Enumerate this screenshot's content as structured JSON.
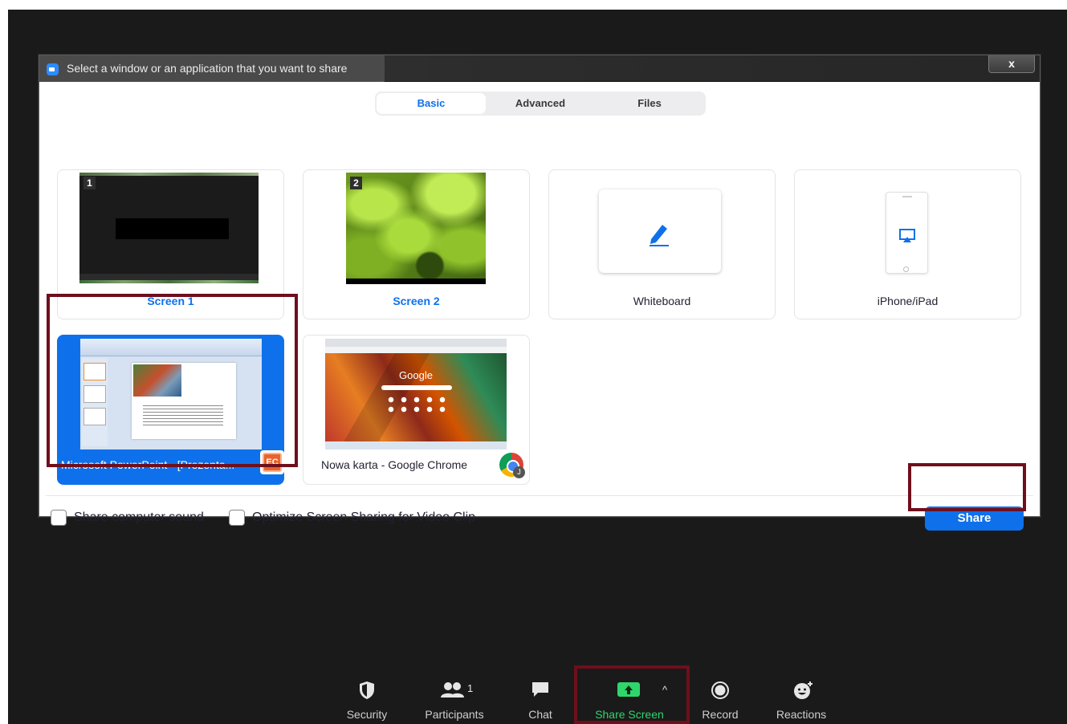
{
  "dialog": {
    "title": "Select a window or an application that you want to share",
    "close_label": "x"
  },
  "tabs": [
    {
      "label": "Basic",
      "active": true
    },
    {
      "label": "Advanced",
      "active": false
    },
    {
      "label": "Files",
      "active": false
    }
  ],
  "tiles": {
    "screen1": {
      "label": "Screen 1",
      "number": "1"
    },
    "screen2": {
      "label": "Screen 2",
      "number": "2"
    },
    "whiteboard": {
      "label": "Whiteboard",
      "icon": "pen-icon"
    },
    "iphone": {
      "label": "iPhone/iPad",
      "icon": "airplay-icon"
    },
    "powerpoint": {
      "label": "Microsoft PowerPoint - [Prezenta...",
      "badge_text": "EC",
      "selected": true
    },
    "chrome": {
      "label": "Nowa karta - Google Chrome",
      "thumb_text": "Google",
      "avatar_letter": "J"
    }
  },
  "options": {
    "share_sound": "Share computer sound",
    "optimize_video": "Optimize Screen Sharing for Video Clip"
  },
  "share_button": "Share",
  "toolbar": {
    "security": "Security",
    "participants": "Participants",
    "participants_count": "1",
    "chat": "Chat",
    "share_screen": "Share Screen",
    "share_caret": "^",
    "record": "Record",
    "reactions": "Reactions"
  },
  "colors": {
    "accent": "#0e71eb",
    "highlight_frame": "#6f0f1c",
    "share_screen_green": "#2fd66b",
    "meeting_bg": "#1a1a1a"
  }
}
